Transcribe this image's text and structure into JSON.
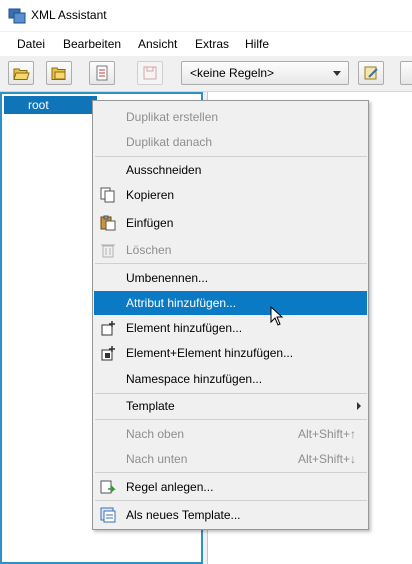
{
  "window": {
    "title": "XML Assistant",
    "app_icon": "xml-assistant-icon"
  },
  "menubar": [
    "Datei",
    "Bearbeiten",
    "Ansicht",
    "Extras",
    "Hilfe"
  ],
  "toolbar": {
    "rules_combo": "<keine Regeln>",
    "buttons": [
      "open-folder-icon",
      "open-folder-2-icon",
      "edit-document-icon",
      "save-icon",
      "rules-edit-icon"
    ]
  },
  "tree": {
    "root_label": "root"
  },
  "context_menu": {
    "items": [
      {
        "label": "Duplikat erstellen",
        "enabled": false,
        "icon": ""
      },
      {
        "label": "Duplikat danach",
        "enabled": false,
        "icon": ""
      },
      {
        "label": "Ausschneiden",
        "enabled": true,
        "icon": ""
      },
      {
        "label": "Kopieren",
        "enabled": true,
        "icon": "copy-icon"
      },
      {
        "label": "Einfügen",
        "enabled": true,
        "icon": "paste-icon"
      },
      {
        "label": "Löschen",
        "enabled": false,
        "icon": "trash-icon"
      },
      {
        "label": "Umbenennen...",
        "enabled": true,
        "icon": ""
      },
      {
        "label": "Attribut hinzufügen...",
        "enabled": true,
        "icon": "",
        "highlighted": true
      },
      {
        "label": "Element hinzufügen...",
        "enabled": true,
        "icon": "add-element-icon"
      },
      {
        "label": "Element+Element hinzufügen...",
        "enabled": true,
        "icon": "add-element-element-icon"
      },
      {
        "label": "Namespace hinzufügen...",
        "enabled": true,
        "icon": ""
      },
      {
        "label": "Template",
        "enabled": true,
        "icon": "",
        "submenu": true
      },
      {
        "label": "Nach oben",
        "enabled": false,
        "icon": "",
        "shortcut": "Alt+Shift+↑"
      },
      {
        "label": "Nach unten",
        "enabled": false,
        "icon": "",
        "shortcut": "Alt+Shift+↓"
      },
      {
        "label": "Regel anlegen...",
        "enabled": true,
        "icon": "create-rule-icon"
      },
      {
        "label": "Als neues Template...",
        "enabled": true,
        "icon": "new-template-icon"
      }
    ]
  },
  "colors": {
    "selection": "#0b7ac5",
    "tree_selection": "#0f75b8",
    "focus_border": "#2f8fc7"
  }
}
